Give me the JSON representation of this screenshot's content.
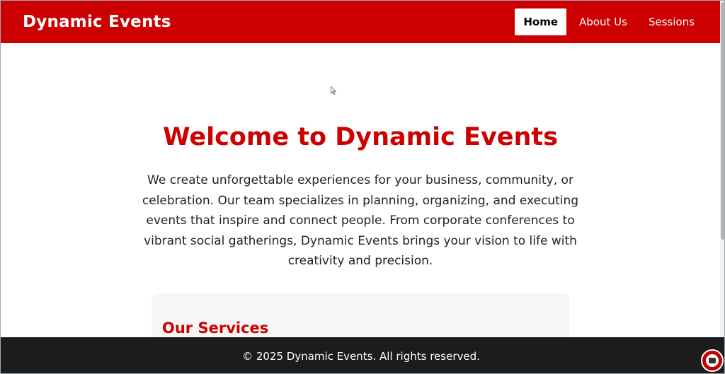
{
  "header": {
    "brand": "Dynamic Events",
    "nav": [
      {
        "label": "Home",
        "active": true
      },
      {
        "label": "About Us",
        "active": false
      },
      {
        "label": "Sessions",
        "active": false
      }
    ]
  },
  "hero": {
    "title": "Welcome to Dynamic Events",
    "description": "We create unforgettable experiences for your business, community, or celebration. Our team specializes in planning, organizing, and executing events that inspire and connect people. From corporate conferences to vibrant social gatherings, Dynamic Events brings your vision to life with creativity and precision."
  },
  "services": {
    "title": "Our Services"
  },
  "footer": {
    "text": "© 2025 Dynamic Events. All rights reserved."
  },
  "colors": {
    "brand": "#cc0000",
    "footer_bg": "#1c1c1c"
  },
  "icons": {
    "cursor": "mouse-pointer-icon",
    "badge": "app-badge-icon"
  }
}
